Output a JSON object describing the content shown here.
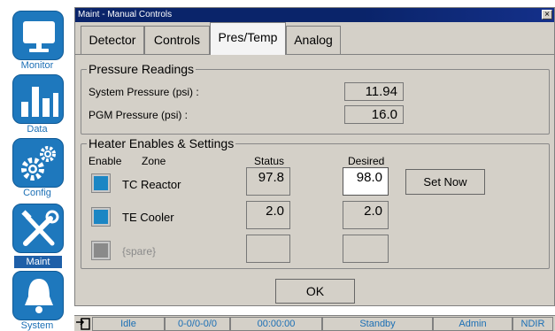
{
  "sidebar": {
    "items": [
      {
        "label": "Monitor",
        "icon": "monitor-icon"
      },
      {
        "label": "Data",
        "icon": "bar-chart-icon"
      },
      {
        "label": "Config",
        "icon": "gears-icon"
      },
      {
        "label": "Maint",
        "icon": "tools-icon",
        "active": true
      },
      {
        "label": "System",
        "icon": "bell-icon"
      }
    ]
  },
  "window": {
    "title": "Maint - Manual Controls",
    "close_glyph": "×"
  },
  "tabs": [
    {
      "label": "Detector"
    },
    {
      "label": "Controls"
    },
    {
      "label": "Pres/Temp",
      "active": true
    },
    {
      "label": "Analog"
    }
  ],
  "pressure": {
    "title": "Pressure Readings",
    "rows": [
      {
        "label": "System Pressure (psi) :",
        "value": "11.94"
      },
      {
        "label": "PGM Pressure (psi) :",
        "value": "16.0"
      }
    ]
  },
  "heater": {
    "title": "Heater Enables & Settings",
    "headers": {
      "enable": "Enable",
      "zone": "Zone",
      "status": "Status",
      "desired": "Desired"
    },
    "rows": [
      {
        "zone": "TC Reactor",
        "status": "97.8",
        "desired": "98.0",
        "enabled": true
      },
      {
        "zone": "TE Cooler",
        "status": "2.0",
        "desired": "2.0",
        "enabled": true
      },
      {
        "zone": "{spare}",
        "status": "",
        "desired": "",
        "enabled": false
      }
    ],
    "set_now_label": "Set Now"
  },
  "ok_label": "OK",
  "statusbar": {
    "state": "Idle",
    "counts": "0-0/0-0/0",
    "time": "00:00:00",
    "mode": "Standby",
    "user": "Admin",
    "detector": "NDIR"
  },
  "colors": {
    "accent": "#1e78bd",
    "titlebar": "#0a246a",
    "panel": "#d4d0c8"
  }
}
